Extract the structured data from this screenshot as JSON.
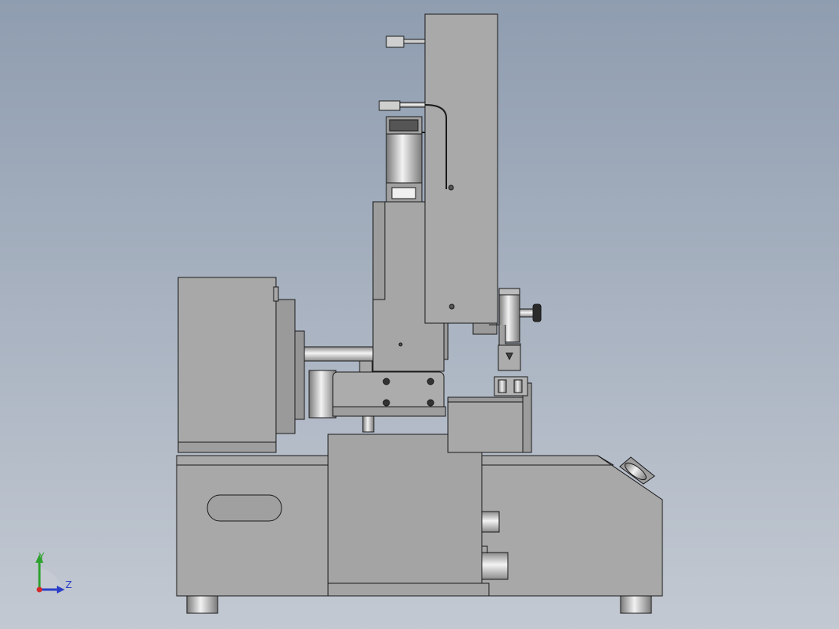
{
  "viewport": {
    "background_top": "#8f9db0",
    "background_bottom": "#c3c9d2",
    "model_fill": "#a8a8a8",
    "model_fill_dark": "#8e8e8e",
    "model_edge": "#1a1a1a"
  },
  "triad": {
    "y_label": "Y",
    "z_label": "Z",
    "y_color": "#2fa12f",
    "z_color": "#2b3fc8",
    "x_color": "#d22b2b"
  }
}
